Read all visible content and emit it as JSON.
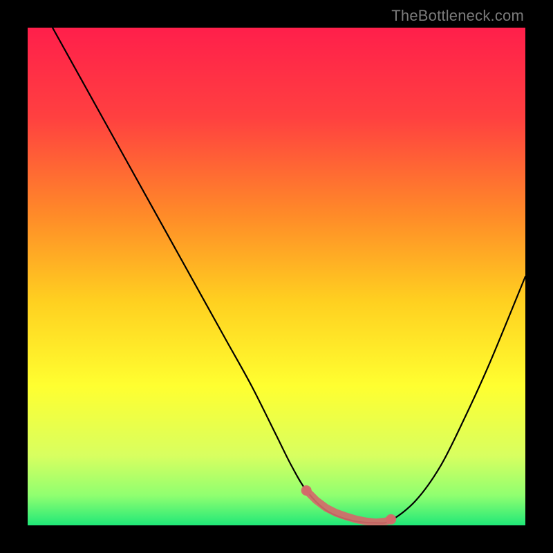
{
  "watermark": "TheBottleneck.com",
  "chart_data": {
    "type": "line",
    "title": "",
    "xlabel": "",
    "ylabel": "",
    "xlim": [
      0,
      100
    ],
    "ylim": [
      0,
      100
    ],
    "background_gradient": {
      "stops": [
        {
          "pos": 0.0,
          "color": "#ff1f4b"
        },
        {
          "pos": 0.18,
          "color": "#ff4040"
        },
        {
          "pos": 0.38,
          "color": "#ff8c28"
        },
        {
          "pos": 0.55,
          "color": "#ffd020"
        },
        {
          "pos": 0.72,
          "color": "#ffff30"
        },
        {
          "pos": 0.86,
          "color": "#d8ff60"
        },
        {
          "pos": 0.94,
          "color": "#90ff70"
        },
        {
          "pos": 1.0,
          "color": "#20e878"
        }
      ]
    },
    "series": [
      {
        "name": "bottleneck-curve",
        "color": "#000000",
        "x": [
          5,
          10,
          15,
          20,
          25,
          30,
          35,
          40,
          45,
          50,
          53,
          56,
          60,
          65,
          70,
          73,
          78,
          83,
          88,
          93,
          100
        ],
        "y": [
          100,
          91,
          82,
          73,
          64,
          55,
          46,
          37,
          28,
          18,
          12,
          7,
          3,
          1,
          0.5,
          1,
          5,
          12,
          22,
          33,
          50
        ]
      }
    ],
    "highlight": {
      "name": "optimal-range",
      "color": "#d46a6a",
      "points_x": [
        56,
        58,
        60,
        62,
        64,
        66,
        68,
        70,
        72,
        73
      ],
      "points_y": [
        7,
        5,
        3.5,
        2.5,
        1.8,
        1.2,
        0.8,
        0.6,
        0.8,
        1.2
      ]
    }
  }
}
